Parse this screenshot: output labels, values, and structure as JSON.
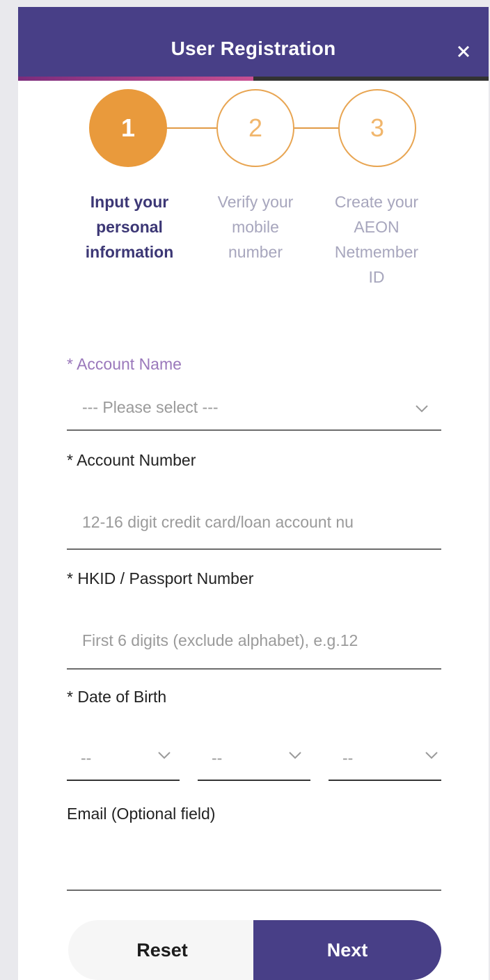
{
  "header": {
    "title": "User Registration",
    "close_icon": "close-icon"
  },
  "progress": {
    "fraction": 0.5
  },
  "stepper": {
    "steps": [
      {
        "number": "1",
        "lines": [
          "Input your",
          "personal",
          "information"
        ],
        "state": "active"
      },
      {
        "number": "2",
        "lines": [
          "Verify your",
          "mobile",
          "number"
        ],
        "state": "pending"
      },
      {
        "number": "3",
        "lines": [
          "Create your",
          "AEON",
          "Netmember",
          "ID"
        ],
        "state": "pending"
      }
    ]
  },
  "form": {
    "account_name": {
      "label": "* Account Name",
      "value": "--- Please select ---"
    },
    "account_number": {
      "label": "* Account Number",
      "placeholder": "12-16 digit credit card/loan account nu"
    },
    "hkid": {
      "label": "* HKID / Passport Number",
      "placeholder": "First 6 digits (exclude alphabet), e.g.12"
    },
    "dob": {
      "label": "* Date of Birth",
      "day": "--",
      "month": "--",
      "year": "--"
    },
    "email": {
      "label": "Email (Optional field)",
      "value": ""
    }
  },
  "actions": {
    "reset_label": "Reset",
    "next_label": "Next"
  },
  "colors": {
    "header_bg": "#483f87",
    "step_active": "#e99a3c",
    "step_pending_border": "#e8a552",
    "progress_accent": "#c84f92",
    "label_accent": "#9a78bb"
  }
}
